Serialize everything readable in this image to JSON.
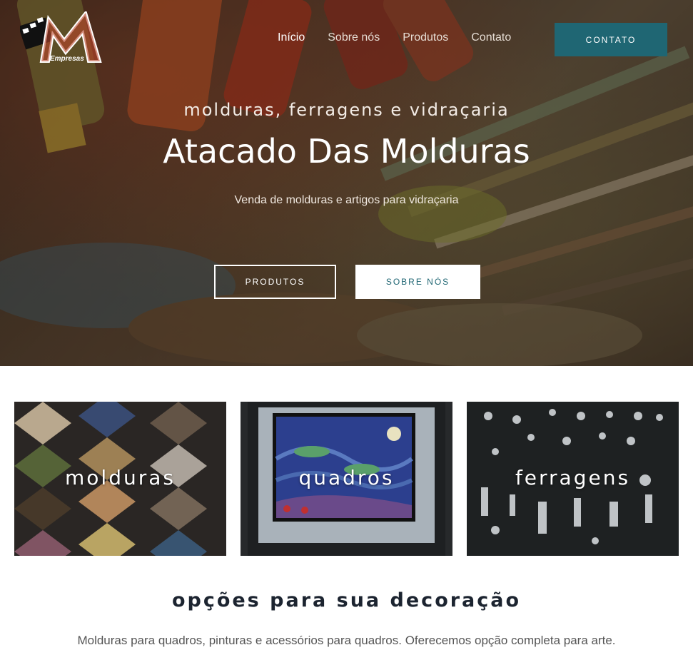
{
  "brand": {
    "logo_text": "Empresas"
  },
  "nav": {
    "items": [
      {
        "label": "Início"
      },
      {
        "label": "Sobre nós"
      },
      {
        "label": "Produtos"
      },
      {
        "label": "Contato"
      }
    ],
    "cta_label": "CONTATO"
  },
  "hero": {
    "kicker": "molduras, ferragens e vidraçaria",
    "title": "Atacado Das Molduras",
    "subtitle": "Venda de molduras e artigos para vidraçaria",
    "btn_produtos": "PRODUTOS",
    "btn_sobre": "SOBRE NÓS"
  },
  "cards": [
    {
      "label": "molduras"
    },
    {
      "label": "quadros"
    },
    {
      "label": "ferragens"
    }
  ],
  "section": {
    "title": "opções para sua decoração",
    "text": "Molduras para quadros, pinturas e acessórios para quadros. Oferecemos opção completa para arte."
  },
  "colors": {
    "accent": "#1f6673",
    "white": "#ffffff",
    "heading": "#1c2430"
  }
}
